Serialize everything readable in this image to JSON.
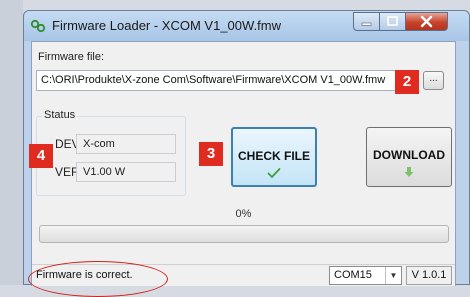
{
  "window": {
    "title": "Firmware Loader - XCOM V1_00W.fmw"
  },
  "firmware": {
    "label": "Firmware file:",
    "path": "C:\\ORI\\Produkte\\X-zone Com\\Software\\Firmware\\XCOM V1_00W.fmw",
    "browse_label": "..."
  },
  "status_group": {
    "title": "Status",
    "dev_label": "DEV:",
    "dev_value": "X-com",
    "ver_label": "VER:",
    "ver_value": "V1.00 W"
  },
  "buttons": {
    "check_file": "CHECK FILE",
    "download": "DOWNLOAD"
  },
  "progress": {
    "percent_text": "0%",
    "value": 0
  },
  "statusbar": {
    "message": "Firmware is correct.",
    "port": "COM15",
    "version": "V 1.0.1"
  },
  "annotations": {
    "badge_2": "2",
    "badge_3": "3",
    "badge_4": "4"
  },
  "colors": {
    "badge": "#e02b20",
    "highlight_oval": "#d0201a",
    "check_icon": "#3aa03a",
    "download_icon": "#7cc36a"
  }
}
